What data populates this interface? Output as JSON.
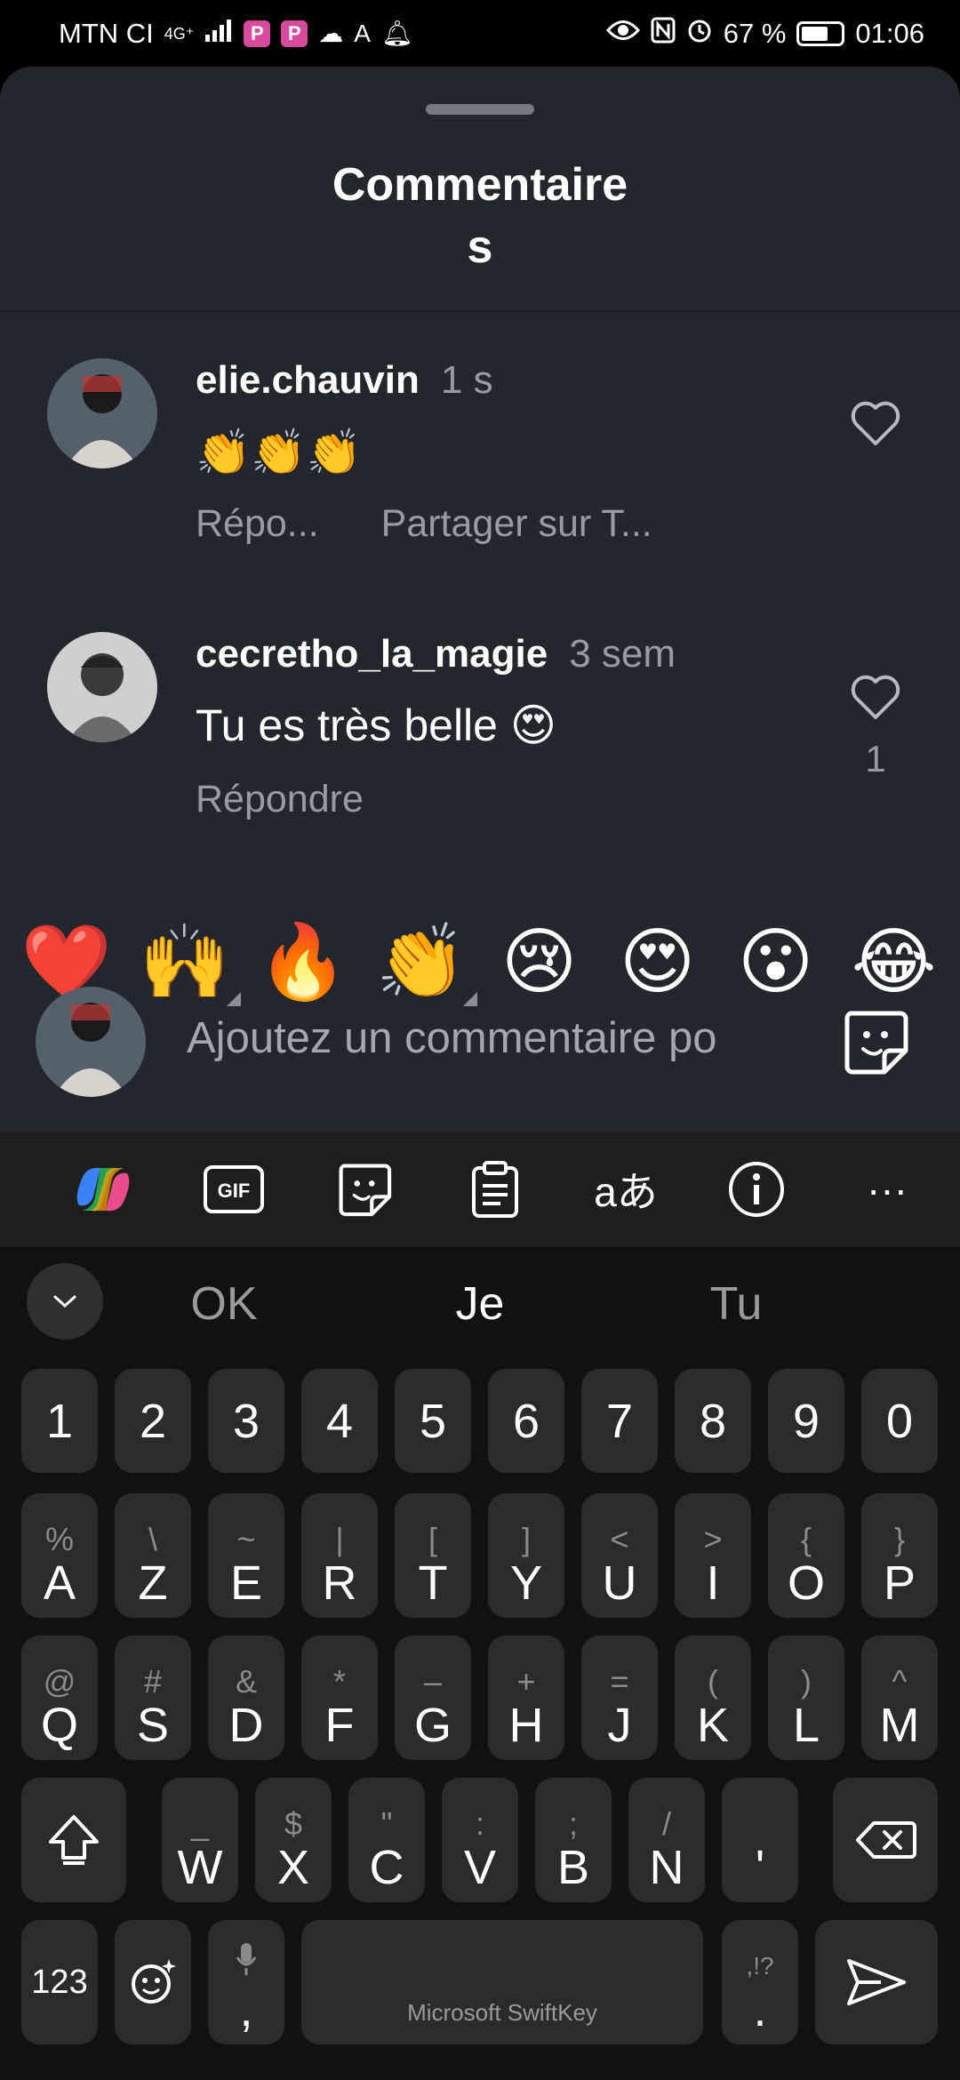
{
  "status_bar": {
    "carrier": "MTN CI",
    "network": "4G⁺",
    "battery": "67 %",
    "time": "01:06",
    "left_icons": [
      "signal-icon",
      "p-app-icon",
      "p-app-icon-2",
      "weather-icon",
      "text-app-icon",
      "bell-icon"
    ],
    "right_icons": [
      "eye-icon",
      "nfc-icon",
      "alarm-icon",
      "battery-icon"
    ]
  },
  "sheet": {
    "title_line1": "Commentaire",
    "title_line2": "s"
  },
  "comments": [
    {
      "username": "elie.chauvin",
      "time": "1 s",
      "text": "👏👏👏",
      "reply": "Répo...",
      "share": "Partager sur T...",
      "likes": ""
    },
    {
      "username": "cecretho_la_magie",
      "time": "3 sem",
      "text": "Tu es très belle 😍",
      "reply": "Répondre",
      "likes": "1"
    }
  ],
  "reactions": [
    "❤️",
    "🙌",
    "🔥",
    "👏",
    "😢",
    "😍",
    "😮",
    "😂"
  ],
  "composer": {
    "placeholder": "Ajoutez un commentaire po"
  },
  "keyboard_toolbar": {
    "gif_label": "GIF",
    "translate_label": "aあ",
    "more_label": "···"
  },
  "suggestions": [
    "OK",
    "Je",
    "Tu"
  ],
  "keyboard": {
    "numbers": [
      "1",
      "2",
      "3",
      "4",
      "5",
      "6",
      "7",
      "8",
      "9",
      "0"
    ],
    "row1": [
      {
        "hint": "%",
        "key": "A"
      },
      {
        "hint": "\\",
        "key": "Z"
      },
      {
        "hint": "~",
        "key": "E"
      },
      {
        "hint": "|",
        "key": "R"
      },
      {
        "hint": "[",
        "key": "T"
      },
      {
        "hint": "]",
        "key": "Y"
      },
      {
        "hint": "<",
        "key": "U"
      },
      {
        "hint": ">",
        "key": "I"
      },
      {
        "hint": "{",
        "key": "O"
      },
      {
        "hint": "}",
        "key": "P"
      }
    ],
    "row2": [
      {
        "hint": "@",
        "key": "Q"
      },
      {
        "hint": "#",
        "key": "S"
      },
      {
        "hint": "&",
        "key": "D"
      },
      {
        "hint": "*",
        "key": "F"
      },
      {
        "hint": "–",
        "key": "G"
      },
      {
        "hint": "+",
        "key": "H"
      },
      {
        "hint": "=",
        "key": "J"
      },
      {
        "hint": "(",
        "key": "K"
      },
      {
        "hint": ")",
        "key": "L"
      },
      {
        "hint": "^",
        "key": "M"
      }
    ],
    "row3": [
      {
        "hint": "_",
        "key": "W"
      },
      {
        "hint": "$",
        "key": "X"
      },
      {
        "hint": "\"",
        "key": "C"
      },
      {
        "hint": ":",
        "key": "V"
      },
      {
        "hint": ";",
        "key": "B"
      },
      {
        "hint": "/",
        "key": "N"
      },
      {
        "hint": "",
        "key": "'"
      }
    ],
    "numbers_key": "123",
    "comma_key": ",",
    "space_label": "Microsoft SwiftKey",
    "period_hint": ",!?",
    "period_key": "."
  }
}
